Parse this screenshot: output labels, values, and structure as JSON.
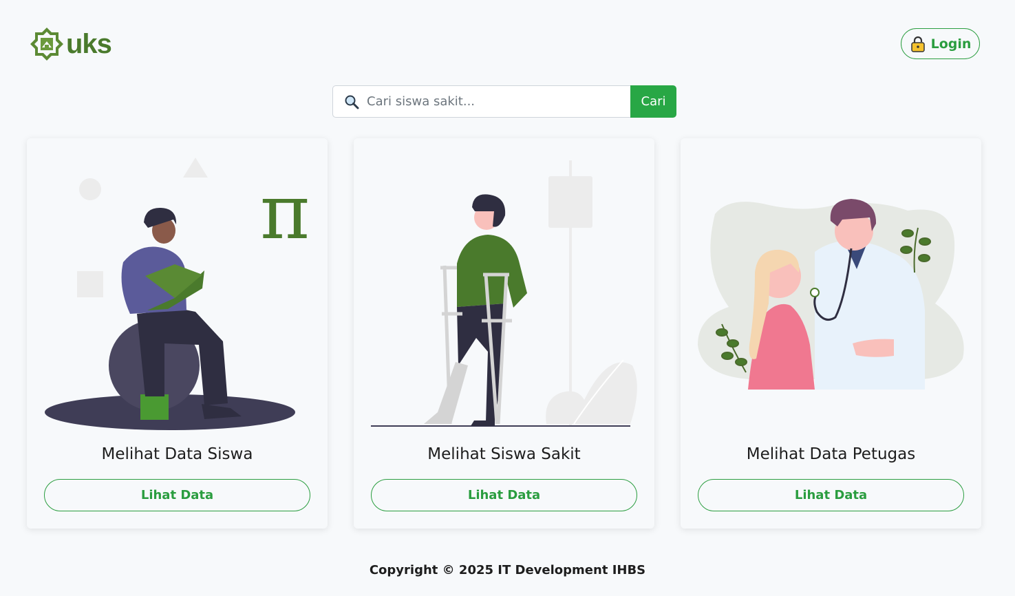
{
  "header": {
    "logo_text": "uks",
    "login_label": "Login"
  },
  "search": {
    "placeholder": "Cari siswa sakit...",
    "value": "",
    "button_label": "Cari"
  },
  "cards": [
    {
      "title": "Melihat Data Siswa",
      "button_label": "Lihat Data",
      "illustration": "student-reading-illustration"
    },
    {
      "title": "Melihat Siswa Sakit",
      "button_label": "Lihat Data",
      "illustration": "injured-student-crutches-illustration"
    },
    {
      "title": "Melihat Data Petugas",
      "button_label": "Lihat Data",
      "illustration": "doctor-patient-illustration"
    }
  ],
  "footer": {
    "copyright": "Copyright © 2025 IT Development IHBS"
  },
  "colors": {
    "accent": "#28a745",
    "brand": "#4a7a2c",
    "background": "#f7f9fb"
  }
}
